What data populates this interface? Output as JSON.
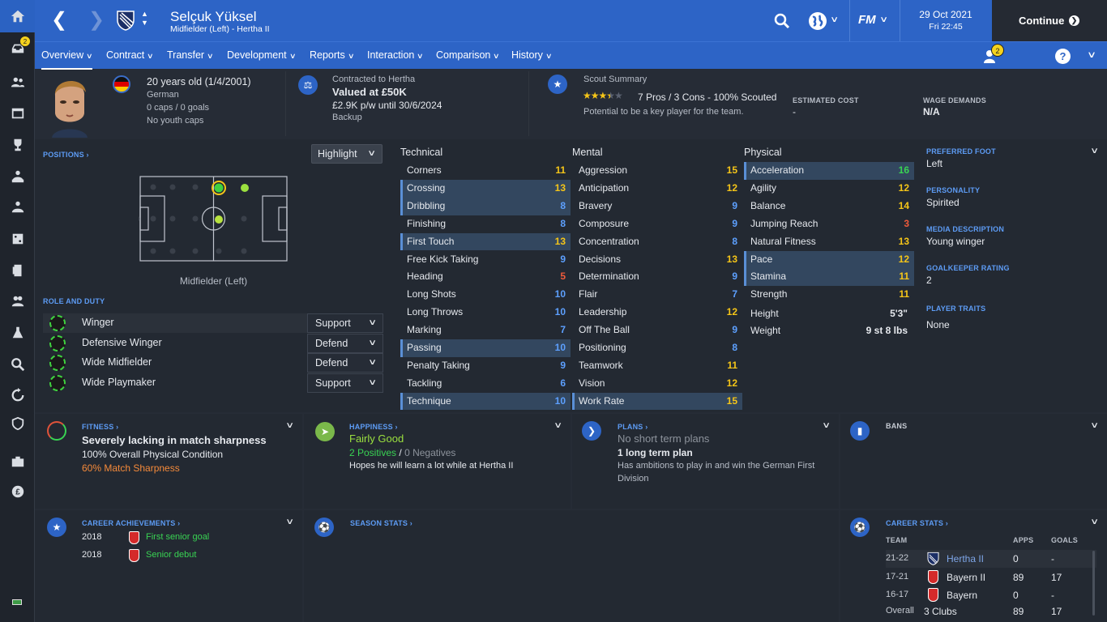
{
  "header": {
    "player_name": "Selçuk Yüksel",
    "subtitle": "Midfielder (Left) - Hertha II",
    "date": "29 Oct 2021",
    "time": "Fri 22:45",
    "continue_label": "Continue",
    "fm_label": "FM"
  },
  "sidebar": {
    "inbox_badge": "2"
  },
  "nav": {
    "tabs": [
      "Overview",
      "Contract",
      "Transfer",
      "Development",
      "Reports",
      "Interaction",
      "Comparison",
      "History"
    ],
    "notif_badge": "2",
    "help": "?"
  },
  "info": {
    "age": "20 years old (1/4/2001)",
    "nationality": "German",
    "caps": "0 caps / 0 goals",
    "youth_caps": "No youth caps",
    "contract_label": "Contracted to Hertha",
    "value": "Valued at £50K",
    "wage": "£2.9K p/w until 30/6/2024",
    "squad_status": "Backup",
    "scout_label": "Scout Summary",
    "scout_text": "7 Pros / 3 Cons - 100% Scouted",
    "scout_stars": 3.5,
    "scout_potential": "Potential to be a key player for the team.",
    "est_cost_label": "ESTIMATED COST",
    "est_cost": "-",
    "wage_demand_label": "WAGE DEMANDS",
    "wage_demand": "N/A"
  },
  "positions": {
    "label": "POSITIONS",
    "highlight": "Highlight",
    "position_name": "Midfielder (Left)",
    "role_label": "ROLE AND DUTY",
    "roles": [
      {
        "name": "Winger",
        "duty": "Support"
      },
      {
        "name": "Defensive Winger",
        "duty": "Defend"
      },
      {
        "name": "Wide Midfielder",
        "duty": "Defend"
      },
      {
        "name": "Wide Playmaker",
        "duty": "Support"
      }
    ]
  },
  "attributes": {
    "technical_label": "Technical",
    "mental_label": "Mental",
    "physical_label": "Physical",
    "technical": [
      {
        "n": "Corners",
        "v": "11",
        "c": "y",
        "h": false
      },
      {
        "n": "Crossing",
        "v": "13",
        "c": "y",
        "h": true
      },
      {
        "n": "Dribbling",
        "v": "8",
        "c": "b",
        "h": true
      },
      {
        "n": "Finishing",
        "v": "8",
        "c": "b",
        "h": false
      },
      {
        "n": "First Touch",
        "v": "13",
        "c": "y",
        "h": true
      },
      {
        "n": "Free Kick Taking",
        "v": "9",
        "c": "b",
        "h": false
      },
      {
        "n": "Heading",
        "v": "5",
        "c": "r",
        "h": false
      },
      {
        "n": "Long Shots",
        "v": "10",
        "c": "b",
        "h": false
      },
      {
        "n": "Long Throws",
        "v": "10",
        "c": "b",
        "h": false
      },
      {
        "n": "Marking",
        "v": "7",
        "c": "b",
        "h": false
      },
      {
        "n": "Passing",
        "v": "10",
        "c": "b",
        "h": true
      },
      {
        "n": "Penalty Taking",
        "v": "9",
        "c": "b",
        "h": false
      },
      {
        "n": "Tackling",
        "v": "6",
        "c": "b",
        "h": false
      },
      {
        "n": "Technique",
        "v": "10",
        "c": "b",
        "h": true
      }
    ],
    "mental": [
      {
        "n": "Aggression",
        "v": "15",
        "c": "y",
        "h": false
      },
      {
        "n": "Anticipation",
        "v": "12",
        "c": "y",
        "h": false
      },
      {
        "n": "Bravery",
        "v": "9",
        "c": "b",
        "h": false
      },
      {
        "n": "Composure",
        "v": "9",
        "c": "b",
        "h": false
      },
      {
        "n": "Concentration",
        "v": "8",
        "c": "b",
        "h": false
      },
      {
        "n": "Decisions",
        "v": "13",
        "c": "y",
        "h": false
      },
      {
        "n": "Determination",
        "v": "9",
        "c": "b",
        "h": false
      },
      {
        "n": "Flair",
        "v": "7",
        "c": "b",
        "h": false
      },
      {
        "n": "Leadership",
        "v": "12",
        "c": "y",
        "h": false
      },
      {
        "n": "Off The Ball",
        "v": "9",
        "c": "b",
        "h": false
      },
      {
        "n": "Positioning",
        "v": "8",
        "c": "b",
        "h": false
      },
      {
        "n": "Teamwork",
        "v": "11",
        "c": "y",
        "h": false
      },
      {
        "n": "Vision",
        "v": "12",
        "c": "y",
        "h": false
      },
      {
        "n": "Work Rate",
        "v": "15",
        "c": "y",
        "h": true
      }
    ],
    "physical": [
      {
        "n": "Acceleration",
        "v": "16",
        "c": "g",
        "h": true
      },
      {
        "n": "Agility",
        "v": "12",
        "c": "y",
        "h": false
      },
      {
        "n": "Balance",
        "v": "14",
        "c": "y",
        "h": false
      },
      {
        "n": "Jumping Reach",
        "v": "3",
        "c": "r",
        "h": false
      },
      {
        "n": "Natural Fitness",
        "v": "13",
        "c": "y",
        "h": false
      },
      {
        "n": "Pace",
        "v": "12",
        "c": "y",
        "h": true
      },
      {
        "n": "Stamina",
        "v": "11",
        "c": "y",
        "h": true
      },
      {
        "n": "Strength",
        "v": "11",
        "c": "y",
        "h": false
      }
    ],
    "height_label": "Height",
    "height": "5'3\"",
    "weight_label": "Weight",
    "weight": "9 st 8 lbs"
  },
  "side": {
    "foot_label": "PREFERRED FOOT",
    "foot": "Left",
    "personality_label": "PERSONALITY",
    "personality": "Spirited",
    "media_label": "MEDIA DESCRIPTION",
    "media": "Young winger",
    "gk_label": "GOALKEEPER RATING",
    "gk": "2",
    "traits_label": "PLAYER TRAITS",
    "traits": "None"
  },
  "fitness": {
    "label": "FITNESS",
    "title": "Severely lacking in match sharpness",
    "condition": "100% Overall Physical Condition",
    "sharpness": "60% Match Sharpness"
  },
  "happiness": {
    "label": "HAPPINESS",
    "title": "Fairly Good",
    "positives": "2 Positives",
    "slash": "/",
    "negatives": "0 Negatives",
    "note": "Hopes he will learn a lot while at Hertha II"
  },
  "plans": {
    "label": "PLANS",
    "title": "No short term plans",
    "long": "1 long term plan",
    "note1": "Has ambitions to play in and win the German First",
    "note2": "Division"
  },
  "bans": {
    "label": "BANS"
  },
  "achievements": {
    "label": "CAREER ACHIEVEMENTS",
    "items": [
      {
        "year": "2018",
        "text": "First senior goal"
      },
      {
        "year": "2018",
        "text": "Senior debut"
      }
    ]
  },
  "season": {
    "label": "SEASON STATS"
  },
  "career": {
    "label": "CAREER STATS",
    "col_team": "TEAM",
    "col_apps": "APPS",
    "col_goals": "GOALS",
    "rows": [
      {
        "season": "21-22",
        "team": "Hertha II",
        "apps": "0",
        "goals": "-"
      },
      {
        "season": "17-21",
        "team": "Bayern II",
        "apps": "89",
        "goals": "17"
      },
      {
        "season": "16-17",
        "team": "Bayern",
        "apps": "0",
        "goals": "-"
      }
    ],
    "overall_label": "Overall",
    "overall_team": "3 Clubs",
    "overall_apps": "89",
    "overall_goals": "17"
  },
  "colors": {
    "accent": "#2d64c6",
    "panel": "#232932",
    "good": "#39d353",
    "average": "#f5c518",
    "poor": "#ef5b3b",
    "low": "#5da0ff"
  }
}
